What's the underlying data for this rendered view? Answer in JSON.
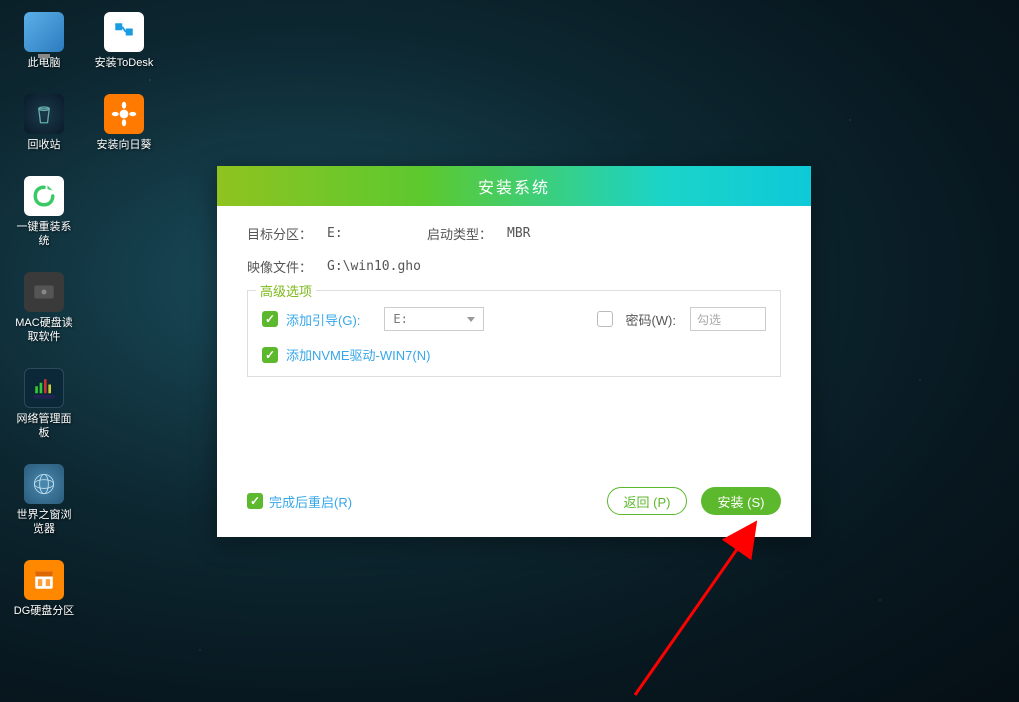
{
  "desktop": {
    "icons": [
      {
        "label": "此电脑",
        "name": "this-pc"
      },
      {
        "label": "安装ToDesk",
        "name": "install-todesk"
      },
      {
        "label": "回收站",
        "name": "recycle-bin"
      },
      {
        "label": "安装向日葵",
        "name": "install-sunflower"
      },
      {
        "label": "一键重装系统",
        "name": "onekey-reinstall"
      },
      {
        "label": "MAC硬盘读取软件",
        "name": "mac-disk-reader"
      },
      {
        "label": "网络管理面板",
        "name": "network-panel"
      },
      {
        "label": "世界之窗浏览器",
        "name": "theworld-browser"
      },
      {
        "label": "DG硬盘分区",
        "name": "dg-partition"
      }
    ]
  },
  "dialog": {
    "title": "安装系统",
    "target_partition_label": "目标分区：",
    "target_partition_value": "E:",
    "boot_type_label": "启动类型：",
    "boot_type_value": "MBR",
    "image_file_label": "映像文件：",
    "image_file_value": "G:\\win10.gho",
    "advanced": {
      "legend": "高级选项",
      "add_boot_label": "添加引导(G):",
      "add_boot_partition": "E:",
      "password_label": "密码(W):",
      "password_placeholder": "勾选",
      "nvme_driver_label": "添加NVME驱动-WIN7(N)"
    },
    "restart_after_label": "完成后重启(R)",
    "return_button": "返回 (P)",
    "install_button": "安装 (S)"
  }
}
